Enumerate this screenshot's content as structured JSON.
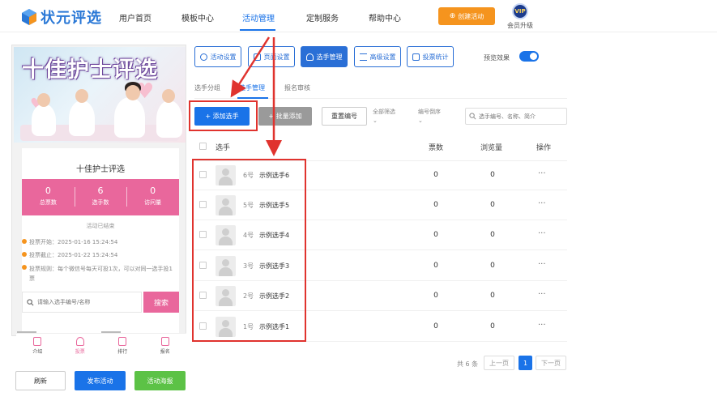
{
  "logo": {
    "text": "状元评选"
  },
  "nav": {
    "items": [
      "用户首页",
      "模板中心",
      "活动管理",
      "定制服务",
      "帮助中心"
    ],
    "active_index": 2,
    "create_label": "创建活动",
    "vip_badge": "VIP",
    "vip_label": "会员升级"
  },
  "preview": {
    "banner_title": "十佳护士评选",
    "card_title": "十佳护士评选",
    "stats": [
      {
        "value": "0",
        "label": "总票数"
      },
      {
        "value": "6",
        "label": "选手数"
      },
      {
        "value": "0",
        "label": "访问量"
      }
    ],
    "status": "活动已结束",
    "info": [
      "投票开始：2025-01-16 15:24:54",
      "投票截止：2025-01-22 15:24:54",
      "投票规则：每个微信号每天可投1次，可以对同一选手投1票"
    ],
    "search_placeholder": "请输入选手编号/名称",
    "search_btn": "搜索",
    "bottom_nav": [
      "介绍",
      "投票",
      "排行",
      "报名"
    ],
    "bottom_nav_active": 1
  },
  "left_actions": {
    "refresh": "刷新",
    "publish": "发布活动",
    "poster": "活动海报"
  },
  "toolbar": {
    "buttons": [
      "活动设置",
      "页面设置",
      "选手管理",
      "高级设置",
      "投票统计"
    ],
    "active_index": 2,
    "preview_label": "预览效果"
  },
  "subtabs": {
    "items": [
      "选手分组",
      "选手管理",
      "报名审核"
    ],
    "active_index": 1
  },
  "actions": {
    "add": "+ 添加选手",
    "batch": "+ 批量添加",
    "reorder": "重置编号",
    "filter": "全部筛选",
    "sort": "编号倒序",
    "search_placeholder": "选手编号、名称、简介"
  },
  "table": {
    "headers": {
      "player": "选手",
      "votes": "票数",
      "views": "浏览量",
      "ops": "操作"
    },
    "rows": [
      {
        "no": "6号",
        "name": "示例选手6",
        "votes": "0",
        "views": "0",
        "more": "···"
      },
      {
        "no": "5号",
        "name": "示例选手5",
        "votes": "0",
        "views": "0",
        "more": "···"
      },
      {
        "no": "4号",
        "name": "示例选手4",
        "votes": "0",
        "views": "0",
        "more": "···"
      },
      {
        "no": "3号",
        "name": "示例选手3",
        "votes": "0",
        "views": "0",
        "more": "···"
      },
      {
        "no": "2号",
        "name": "示例选手2",
        "votes": "0",
        "views": "0",
        "more": "···"
      },
      {
        "no": "1号",
        "name": "示例选手1",
        "votes": "0",
        "views": "0",
        "more": "···"
      }
    ]
  },
  "pagination": {
    "total": "共 6 条",
    "prev": "上一页",
    "page": "1",
    "next": "下一页"
  },
  "colors": {
    "primary": "#1a73e8",
    "pink": "#e9679c",
    "orange": "#f5941e",
    "green": "#5cc246",
    "annotation": "#e0332e"
  }
}
